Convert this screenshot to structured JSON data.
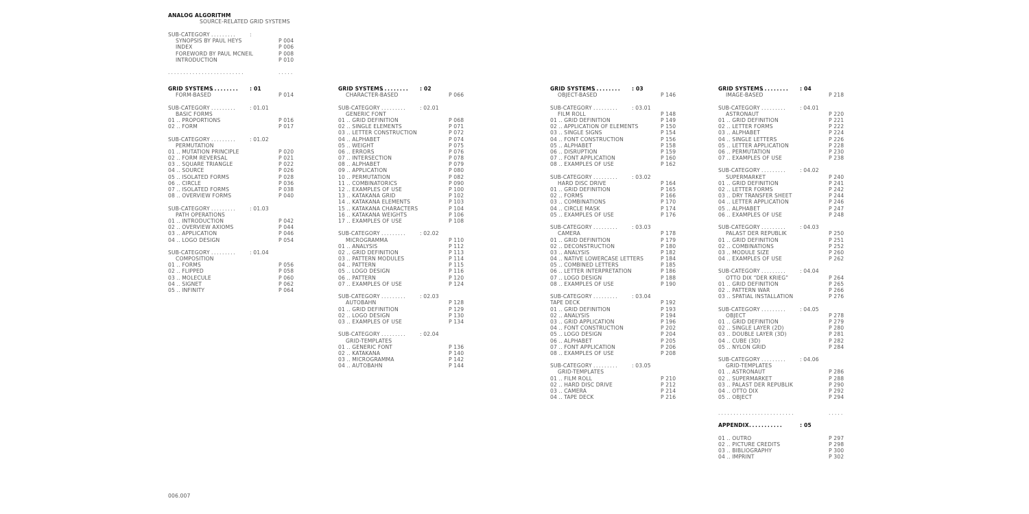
{
  "document": {
    "title": "ANALOG ALGORITHM",
    "subtitle": "SOURCE-RELATED GRID SYSTEMS",
    "page_number": "006.007",
    "separator_dots": ".........................",
    "separator_short": "....."
  },
  "intro": {
    "label": "SUB-CATEGORY",
    "leader": ".........",
    "code": ":",
    "items": [
      {
        "title": "SYNOPSIS BY PAUL HEYS",
        "page": "P 004"
      },
      {
        "title": "INDEX",
        "page": "P 006"
      },
      {
        "title": "FOREWORD BY PAUL MCNEIL",
        "page": "P 008"
      },
      {
        "title": "INTRODUCTION",
        "page": "P 010"
      }
    ]
  },
  "columns": [
    {
      "label": "GRID SYSTEMS",
      "leader": ".........",
      "code": ": 01",
      "name": "FORM-BASED",
      "page": "P 014",
      "subcategories": [
        {
          "label": "SUB-CATEGORY",
          "leader": ".........",
          "code": ": 01.01",
          "name": "BASIC FORMS",
          "page": "",
          "items": [
            {
              "n": "01",
              "title": "PROPORTIONS",
              "page": "P 016"
            },
            {
              "n": "02",
              "title": "FORM",
              "page": "P 017"
            }
          ]
        },
        {
          "label": "SUB-CATEGORY",
          "leader": ".........",
          "code": ": 01.02",
          "name": "PERMUTATION",
          "page": "",
          "items": [
            {
              "n": "01",
              "title": "MUTATION PRINCIPLE",
              "page": "P 020"
            },
            {
              "n": "02",
              "title": "FORM REVERSAL",
              "page": "P 021"
            },
            {
              "n": "03",
              "title": "SQUARE TRIANGLE",
              "page": "P 022"
            },
            {
              "n": "04",
              "title": "SOURCE",
              "page": "P 026"
            },
            {
              "n": "05",
              "title": "ISOLATED FORMS",
              "page": "P 028"
            },
            {
              "n": "06",
              "title": "CIRCLE",
              "page": "P 036"
            },
            {
              "n": "07",
              "title": "ISOLATED FORMS",
              "page": "P 038"
            },
            {
              "n": "08",
              "title": "OVERVIEW FORMS",
              "page": "P 040"
            }
          ]
        },
        {
          "label": "SUB-CATEGORY",
          "leader": ".........",
          "code": ": 01.03",
          "name": "PATH OPERATIONS",
          "page": "",
          "items": [
            {
              "n": "01",
              "title": "INTRODUCTION",
              "page": "P 042"
            },
            {
              "n": "02",
              "title": "OVERVIEW AXIOMS",
              "page": "P 044"
            },
            {
              "n": "03",
              "title": "APPLICATION",
              "page": "P 046"
            },
            {
              "n": "04",
              "title": "LOGO DESIGN",
              "page": "P 054"
            }
          ]
        },
        {
          "label": "SUB-CATEGORY",
          "leader": ".........",
          "code": ": 01.04",
          "name": "COMPOSITION",
          "page": "",
          "items": [
            {
              "n": "01",
              "title": "FORMS",
              "page": "P 056"
            },
            {
              "n": "02",
              "title": "FLIPPED",
              "page": "P 058"
            },
            {
              "n": "03",
              "title": "MOLECULE",
              "page": "P 060"
            },
            {
              "n": "04",
              "title": "SIGNET",
              "page": "P 062"
            },
            {
              "n": "05",
              "title": "INFINITY",
              "page": "P 064"
            }
          ]
        }
      ]
    },
    {
      "label": "GRID SYSTEMS",
      "leader": ".........",
      "code": ": 02",
      "name": "CHARACTER-BASED",
      "page": "P 066",
      "subcategories": [
        {
          "label": "SUB-CATEGORY",
          "leader": ".........",
          "code": ": 02.01",
          "name": "GENERIC FONT",
          "page": "",
          "items": [
            {
              "n": "01",
              "title": "GRID DEFINITION",
              "page": "P 068"
            },
            {
              "n": "02",
              "title": "SINGLE ELEMENTS",
              "page": "P 071"
            },
            {
              "n": "03",
              "title": "LETTER CONSTRUCTION",
              "page": "P 072"
            },
            {
              "n": "04",
              "title": "ALPHABET",
              "page": "P 074"
            },
            {
              "n": "05",
              "title": "WEIGHT",
              "page": "P 075"
            },
            {
              "n": "06",
              "title": "ERRORS",
              "page": "P 076"
            },
            {
              "n": "07",
              "title": "INTERSECTION",
              "page": "P 078"
            },
            {
              "n": "08",
              "title": "ALPHABET",
              "page": "P 079"
            },
            {
              "n": "09",
              "title": "APPLICATION",
              "page": "P 080"
            },
            {
              "n": "10",
              "title": "PERMUTATION",
              "page": "P 082"
            },
            {
              "n": "11",
              "title": "COMBINATORICS",
              "page": "P 090"
            },
            {
              "n": "12",
              "title": "EXAMPLES OF USE",
              "page": "P 100"
            },
            {
              "n": "13",
              "title": "KATAKANA GRID",
              "page": "P 102"
            },
            {
              "n": "14",
              "title": "KATAKANA ELEMENTS",
              "page": "P 103"
            },
            {
              "n": "15",
              "title": "KATAKANA CHARACTERS",
              "page": "P 104"
            },
            {
              "n": "16",
              "title": "KATAKANA WEIGHTS",
              "page": "P 106"
            },
            {
              "n": "17",
              "title": "EXAMPLES OF USE",
              "page": "P 108"
            }
          ]
        },
        {
          "label": "SUB-CATEGORY",
          "leader": ".........",
          "code": ": 02.02",
          "name": "MICROGRAMMA",
          "page": "P 110",
          "items": [
            {
              "n": "01",
              "title": "ANALYSIS",
              "page": "P 112"
            },
            {
              "n": "02",
              "title": "GRID DEFINITION",
              "page": "P 113"
            },
            {
              "n": "03",
              "title": "PATTERN MODULES",
              "page": "P 114"
            },
            {
              "n": "04",
              "title": "PATTERN",
              "page": "P 115"
            },
            {
              "n": "05",
              "title": "LOGO DESIGN",
              "page": "P 116"
            },
            {
              "n": "06",
              "title": "PATTERN",
              "page": "P 120"
            },
            {
              "n": "07",
              "title": "EXAMPLES OF USE",
              "page": "P 124"
            }
          ]
        },
        {
          "label": "SUB-CATEGORY",
          "leader": ".........",
          "code": ": 02.03",
          "name": "AUTOBAHN",
          "page": "P 128",
          "items": [
            {
              "n": "01",
              "title": "GRID DEFINITION",
              "page": "P 129"
            },
            {
              "n": "02",
              "title": "LOGO DESIGN",
              "page": "P 130"
            },
            {
              "n": "03",
              "title": "EXAMPLES OF USE",
              "page": "P 134"
            }
          ]
        },
        {
          "label": "SUB-CATEGORY",
          "leader": ".........",
          "code": ": 02.04",
          "name": "GRID-TEMPLATES",
          "page": "",
          "items": [
            {
              "n": "01",
              "title": "GENERIC FONT",
              "page": "P 136"
            },
            {
              "n": "02",
              "title": "KATAKANA",
              "page": "P 140"
            },
            {
              "n": "03",
              "title": "MICROGRAMMA",
              "page": "P 142"
            },
            {
              "n": "04",
              "title": "AUTOBAHN",
              "page": "P 144"
            }
          ]
        }
      ]
    },
    {
      "label": "GRID SYSTEMS",
      "leader": ".........",
      "code": ": 03",
      "name": "OBJECT-BASED",
      "page": "P 146",
      "subcategories": [
        {
          "label": "SUB-CATEGORY",
          "leader": ".........",
          "code": ": 03.01",
          "name": "FILM ROLL",
          "page": "P 148",
          "items": [
            {
              "n": "01",
              "title": "GRID DEFINITION",
              "page": "P 149"
            },
            {
              "n": "02",
              "title": "APPLICATION OF ELEMENTS",
              "page": "P 150"
            },
            {
              "n": "03",
              "title": "SINGLE SIGNS",
              "page": "P 154"
            },
            {
              "n": "04",
              "title": "FONT CONSTRUCTION",
              "page": "P 156"
            },
            {
              "n": "05",
              "title": "ALPHABET",
              "page": "P 158"
            },
            {
              "n": "06",
              "title": "DISRUPTION",
              "page": "P 159"
            },
            {
              "n": "07",
              "title": "FONT APPLICATION",
              "page": "P 160"
            },
            {
              "n": "08",
              "title": "EXAMPLES OF USE",
              "page": "P 162"
            }
          ]
        },
        {
          "label": "SUB-CATEGORY",
          "leader": ".........",
          "code": ": 03.02",
          "name": "HARD DISC DRIVE",
          "page": "P 164",
          "items": [
            {
              "n": "01",
              "title": "GRID DEFINITION",
              "page": "P 165"
            },
            {
              "n": "02",
              "title": "FORMS",
              "page": "P 166"
            },
            {
              "n": "03",
              "title": "COMBINATIONS",
              "page": "P 170"
            },
            {
              "n": "04",
              "title": "CIRCLE MASK",
              "page": "P 174"
            },
            {
              "n": "05",
              "title": "EXAMPLES OF USE",
              "page": "P 176"
            }
          ]
        },
        {
          "label": "SUB-CATEGORY",
          "leader": ".........",
          "code": ": 03.03",
          "name": "CAMERA",
          "page": "P 178",
          "items": [
            {
              "n": "01",
              "title": "GRID DEFINITION",
              "page": "P 179"
            },
            {
              "n": "02",
              "title": "DECONSTRUCTION",
              "page": "P 180"
            },
            {
              "n": "03",
              "title": "ANALYSIS",
              "page": "P 182"
            },
            {
              "n": "04",
              "title": "NATIVE LOWERCASE LETTERS",
              "page": "P 184"
            },
            {
              "n": "05",
              "title": "COMBINED LETTERS",
              "page": "P 185"
            },
            {
              "n": "06",
              "title": "LETTER INTERPRETATION",
              "page": "P 186"
            },
            {
              "n": "07",
              "title": "LOGO DESIGN",
              "page": "P 188"
            },
            {
              "n": "08",
              "title": "EXAMPLES OF USE",
              "page": "P 190"
            }
          ]
        },
        {
          "label": "SUB-CATEGORY",
          "leader": ".........",
          "code": ": 03.04",
          "name": "TAPE DECK",
          "page": "P 192",
          "noindent": true,
          "items": [
            {
              "n": "01",
              "title": "GRID DEFINITION",
              "page": "P 193"
            },
            {
              "n": "02",
              "title": "ANALYSIS",
              "page": "P 194"
            },
            {
              "n": "03",
              "title": "GRID APPLICATION",
              "page": "P 196"
            },
            {
              "n": "04",
              "title": "FONT CONSTRUCTION",
              "page": "P 202"
            },
            {
              "n": "05",
              "title": "LOGO DESIGN",
              "page": "P 204"
            },
            {
              "n": "06",
              "title": "ALPHABET",
              "page": "P 205"
            },
            {
              "n": "07",
              "title": "FONT APPLICATION",
              "page": "P 206"
            },
            {
              "n": "08",
              "title": "EXAMPLES OF USE",
              "page": "P 208"
            }
          ]
        },
        {
          "label": "SUB-CATEGORY",
          "leader": ".........",
          "code": ": 03.05",
          "name": "GRID-TEMPLATES",
          "page": "",
          "items": [
            {
              "n": "01",
              "title": "FILM ROLL",
              "page": "P 210"
            },
            {
              "n": "02",
              "title": "HARD DISC DRIVE",
              "page": "P 212"
            },
            {
              "n": "03",
              "title": "CAMERA",
              "page": "P 214"
            },
            {
              "n": "04",
              "title": "TAPE DECK",
              "page": "P 216"
            }
          ]
        }
      ]
    },
    {
      "label": "GRID SYSTEMS",
      "leader": ".........",
      "code": ": 04",
      "name": "IMAGE-BASED",
      "page": "P 218",
      "subcategories": [
        {
          "label": "SUB-CATEGORY",
          "leader": ".........",
          "code": ": 04.01",
          "name": "ASTRONAUT",
          "page": "P 220",
          "items": [
            {
              "n": "01",
              "title": "GRID DEFINITION",
              "page": "P 221"
            },
            {
              "n": "02",
              "title": "LETTER FORMS",
              "page": "P 222"
            },
            {
              "n": "03",
              "title": "ALPHABET",
              "page": "P 224"
            },
            {
              "n": "04",
              "title": "SINGLE LETTERS",
              "page": "P 226"
            },
            {
              "n": "05",
              "title": "LETTER APPLICATION",
              "page": "P 228"
            },
            {
              "n": "06",
              "title": "PERMUTATION",
              "page": "P 230"
            },
            {
              "n": "07",
              "title": "EXAMPLES OF USE",
              "page": "P 238"
            }
          ]
        },
        {
          "label": "SUB-CATEGORY",
          "leader": ".........",
          "code": ": 04.02",
          "name": "SUPERMARKET",
          "page": "P 240",
          "items": [
            {
              "n": "01",
              "title": "GRID DEFINITION",
              "page": "P 241"
            },
            {
              "n": "02",
              "title": "LETTER FORMS",
              "page": "P 242"
            },
            {
              "n": "03",
              "title": "DRY TRANSFER SHEET",
              "page": "P 244"
            },
            {
              "n": "04",
              "title": "LETTER APPLICATION",
              "page": "P 246"
            },
            {
              "n": "05",
              "title": "ALPHABET",
              "page": "P 247"
            },
            {
              "n": "06",
              "title": "EXAMPLES OF USE",
              "page": "P 248"
            }
          ]
        },
        {
          "label": "SUB-CATEGORY",
          "leader": ".........",
          "code": ": 04.03",
          "name": "PALAST DER REPUBLIK",
          "page": "P 250",
          "items": [
            {
              "n": "01",
              "title": "GRID DEFINITION",
              "page": "P 251"
            },
            {
              "n": "02",
              "title": "COMBINATIONS",
              "page": "P 252"
            },
            {
              "n": "03",
              "title": "MODULE SIZE",
              "page": "P 260"
            },
            {
              "n": "04",
              "title": "EXAMPLES OF USE",
              "page": "P 262"
            }
          ]
        },
        {
          "label": "SUB-CATEGORY",
          "leader": ".........",
          "code": ": 04.04",
          "name": "OTTO DIX “DER KRIEG”",
          "page": "P 264",
          "items": [
            {
              "n": "01",
              "title": "GRID DEFINITION",
              "page": "P 265"
            },
            {
              "n": "02",
              "title": "PATTERN WAR",
              "page": "P 266"
            },
            {
              "n": "03",
              "title": "SPATIAL INSTALLATION",
              "page": "P 276"
            }
          ]
        },
        {
          "label": "SUB-CATEGORY",
          "leader": ".........",
          "code": ": 04.05",
          "name": "OBJECT",
          "page": "P 278",
          "items": [
            {
              "n": "01",
              "title": "GRID DEFINITION",
              "page": "P 279"
            },
            {
              "n": "02",
              "title": "SINGLE LAYER (2D)",
              "page": "P 280"
            },
            {
              "n": "03",
              "title": "DOUBLE LAYER (3D)",
              "page": "P 281"
            },
            {
              "n": "04",
              "title": "CUBE (3D)",
              "page": "P 282"
            },
            {
              "n": "05",
              "title": "NYLON GRID",
              "page": "P 284"
            }
          ]
        },
        {
          "label": "SUB-CATEGORY",
          "leader": ".........",
          "code": ": 04.06",
          "name": "GRID-TEMPLATES",
          "page": "",
          "items": [
            {
              "n": "01",
              "title": "ASTRONAUT",
              "page": "P 286"
            },
            {
              "n": "02",
              "title": "SUPERMARKET",
              "page": "P 288"
            },
            {
              "n": "03",
              "title": "PALAST DER REPUBLIK",
              "page": "P 290"
            },
            {
              "n": "04",
              "title": "OTTO DIX",
              "page": "P 292"
            },
            {
              "n": "05",
              "title": "OBJECT",
              "page": "P 294"
            }
          ]
        }
      ]
    }
  ],
  "appendix": {
    "label": "APPENDIX",
    "leader": "...........",
    "code": ": 05",
    "items": [
      {
        "n": "01",
        "title": "OUTRO",
        "page": "P 297"
      },
      {
        "n": "02",
        "title": "PICTURE CREDITS",
        "page": "P 298"
      },
      {
        "n": "03",
        "title": "BIBLIOGRAPHY",
        "page": "P 300"
      },
      {
        "n": "04",
        "title": "IMPRINT",
        "page": "P 302"
      }
    ]
  }
}
